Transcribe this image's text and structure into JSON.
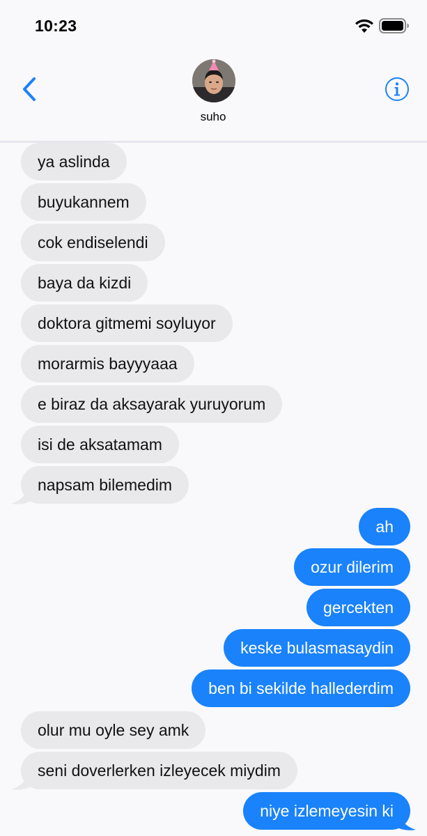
{
  "status": {
    "time": "10:23"
  },
  "header": {
    "contact_name": "suho"
  },
  "colors": {
    "accent": "#1a82fb",
    "incoming_bubble": "#e9e9eb",
    "background": "#f9f9fb"
  },
  "messages": [
    {
      "from": "them",
      "text": "ya aslinda"
    },
    {
      "from": "them",
      "text": "buyukannem"
    },
    {
      "from": "them",
      "text": "cok endiselendi"
    },
    {
      "from": "them",
      "text": "baya da kizdi"
    },
    {
      "from": "them",
      "text": "doktora gitmemi soyluyor"
    },
    {
      "from": "them",
      "text": "morarmis bayyyaaa"
    },
    {
      "from": "them",
      "text": "e biraz da aksayarak yuruyorum"
    },
    {
      "from": "them",
      "text": "isi de aksatamam"
    },
    {
      "from": "them",
      "text": "napsam bilemedim"
    },
    {
      "from": "me",
      "text": "ah"
    },
    {
      "from": "me",
      "text": "ozur dilerim"
    },
    {
      "from": "me",
      "text": "gercekten"
    },
    {
      "from": "me",
      "text": "keske bulasmasaydin"
    },
    {
      "from": "me",
      "text": "ben bi sekilde hallederdim"
    },
    {
      "from": "them",
      "text": "olur mu oyle sey amk"
    },
    {
      "from": "them",
      "text": "seni doverlerken izleyecek miydim"
    },
    {
      "from": "me",
      "text": "niye izlemeyesin ki"
    }
  ]
}
